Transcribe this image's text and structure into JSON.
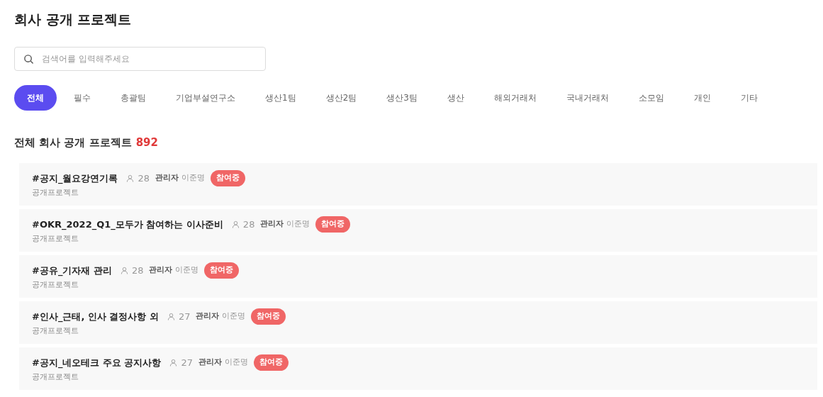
{
  "page": {
    "title": "회사 공개 프로젝트"
  },
  "search": {
    "placeholder": "검색어를 입력해주세요"
  },
  "tabs": [
    {
      "label": "전체",
      "selected": true
    },
    {
      "label": "필수",
      "selected": false
    },
    {
      "label": "총괄팀",
      "selected": false
    },
    {
      "label": "기업부설연구소",
      "selected": false
    },
    {
      "label": "생산1팀",
      "selected": false
    },
    {
      "label": "생산2팀",
      "selected": false
    },
    {
      "label": "생산3팀",
      "selected": false
    },
    {
      "label": "생산",
      "selected": false
    },
    {
      "label": "해외거래처",
      "selected": false
    },
    {
      "label": "국내거래처",
      "selected": false
    },
    {
      "label": "소모임",
      "selected": false
    },
    {
      "label": "개인",
      "selected": false
    },
    {
      "label": "기타",
      "selected": false
    }
  ],
  "section": {
    "title": "전체 회사 공개 프로젝트",
    "count": "892"
  },
  "projects": [
    {
      "name": "#공지_월요강연기록",
      "members": "28",
      "admin_label": "관리자",
      "admin": "이준명",
      "badge": "참여중",
      "subtitle": "공개프로젝트"
    },
    {
      "name": "#OKR_2022_Q1_모두가 참여하는 이사준비",
      "members": "28",
      "admin_label": "관리자",
      "admin": "이준명",
      "badge": "참여중",
      "subtitle": "공개프로젝트"
    },
    {
      "name": "#공유_기자재 관리",
      "members": "28",
      "admin_label": "관리자",
      "admin": "이준명",
      "badge": "참여중",
      "subtitle": "공개프로젝트"
    },
    {
      "name": "#인사_근태, 인사 결정사항 외",
      "members": "27",
      "admin_label": "관리자",
      "admin": "이준명",
      "badge": "참여중",
      "subtitle": "공개프로젝트"
    },
    {
      "name": "#공지_네오테크 주요 공지사항",
      "members": "27",
      "admin_label": "관리자",
      "admin": "이준명",
      "badge": "참여중",
      "subtitle": "공개프로젝트"
    }
  ]
}
